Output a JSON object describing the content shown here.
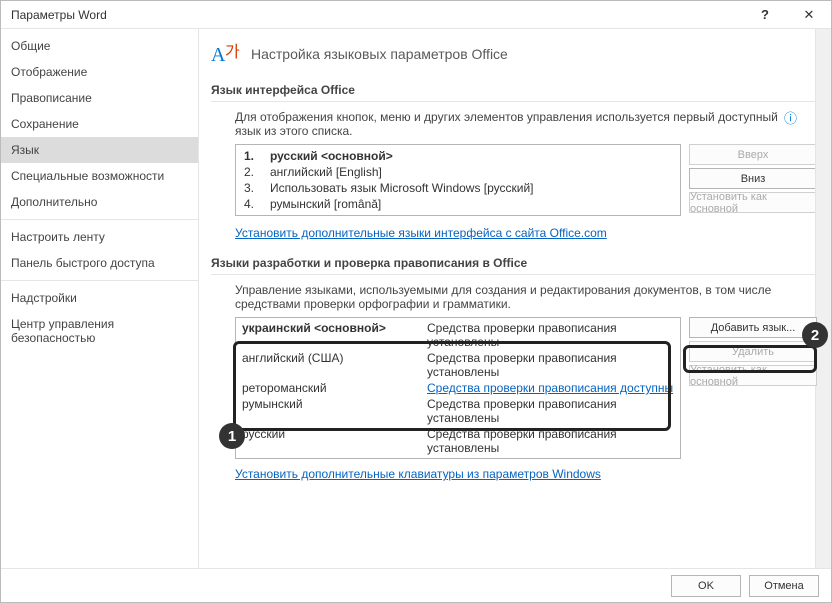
{
  "window": {
    "title": "Параметры Word",
    "help": "?",
    "close": "✕"
  },
  "sidebar": {
    "items": [
      {
        "label": "Общие"
      },
      {
        "label": "Отображение"
      },
      {
        "label": "Правописание"
      },
      {
        "label": "Сохранение"
      },
      {
        "label": "Язык",
        "selected": true
      },
      {
        "label": "Специальные возможности"
      },
      {
        "label": "Дополнительно"
      },
      {
        "sep": true
      },
      {
        "label": "Настроить ленту"
      },
      {
        "label": "Панель быстрого доступа"
      },
      {
        "sep": true
      },
      {
        "label": "Надстройки"
      },
      {
        "label": "Центр управления безопасностью"
      }
    ]
  },
  "header": {
    "title": "Настройка языковых параметров Office"
  },
  "ui_lang": {
    "section": "Язык интерфейса Office",
    "desc": "Для отображения кнопок, меню и других элементов управления используется первый доступный язык из этого списка.",
    "items": [
      {
        "n": "1.",
        "label": "русский <основной>",
        "primary": true
      },
      {
        "n": "2.",
        "label": "английский [English]"
      },
      {
        "n": "3.",
        "label": "Использовать язык Microsoft Windows [русский]"
      },
      {
        "n": "4.",
        "label": "румынский [română]"
      }
    ],
    "btn_up": "Вверх",
    "btn_down": "Вниз",
    "btn_default": "Установить как основной",
    "link": "Установить дополнительные языки интерфейса с сайта Office.com"
  },
  "auth_lang": {
    "section": "Языки разработки и проверка правописания в Office",
    "desc": "Управление языками, используемыми для создания и редактирования документов, в том числе средствами проверки орфографии и грамматики.",
    "rows": [
      {
        "name": "украинский <основной>",
        "status": "Средства проверки правописания установлены",
        "primary": true
      },
      {
        "name": "английский (США)",
        "status": "Средства проверки правописания установлены"
      },
      {
        "name": "ретороманский",
        "status": "Средства проверки правописания доступны",
        "status_link": true
      },
      {
        "name": "румынский",
        "status": "Средства проверки правописания установлены"
      },
      {
        "name": "русский",
        "status": "Средства проверки правописания установлены"
      }
    ],
    "btn_add": "Добавить язык...",
    "btn_remove": "Удалить",
    "btn_default": "Установить как основной",
    "link": "Установить дополнительные клавиатуры из параметров Windows"
  },
  "footer": {
    "ok": "OK",
    "cancel": "Отмена"
  },
  "annotations": {
    "one": "1",
    "two": "2"
  }
}
